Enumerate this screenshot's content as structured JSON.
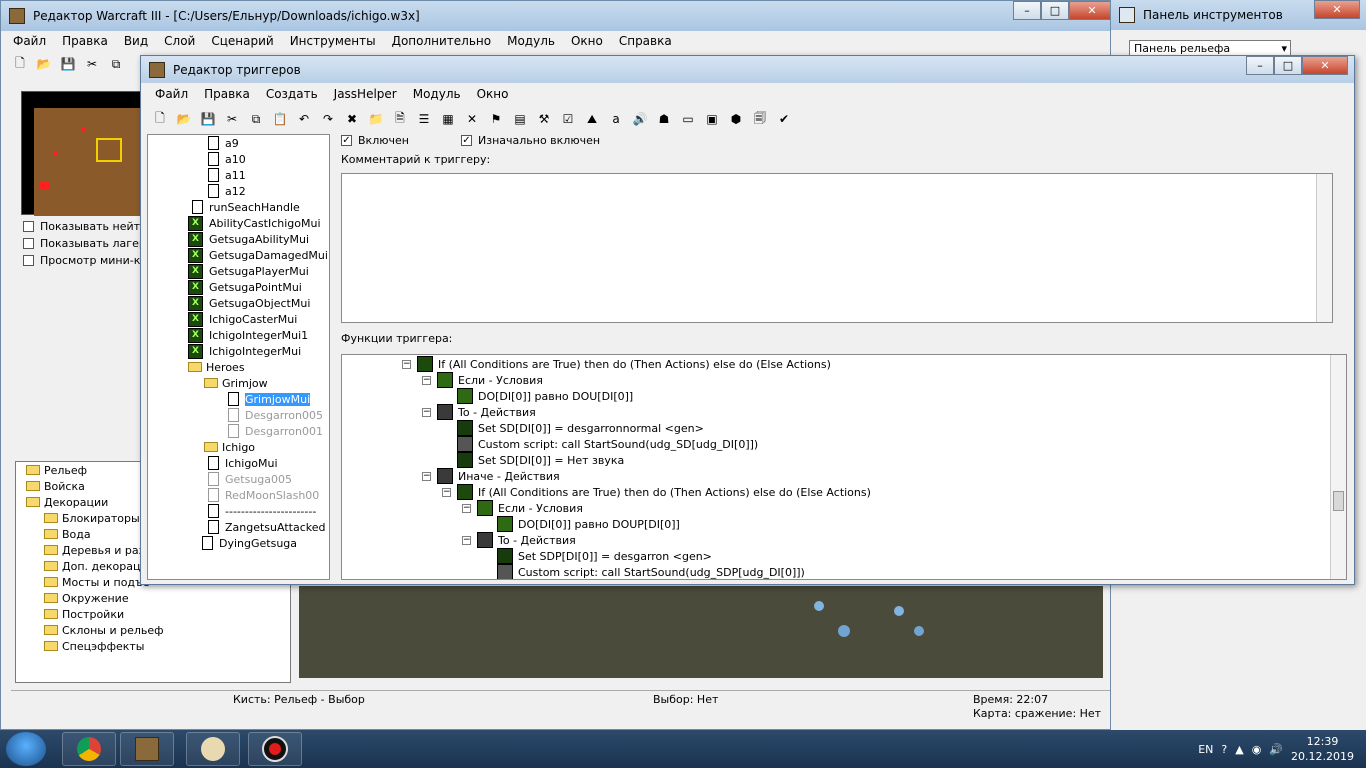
{
  "main_window": {
    "title": "Редактор Warcraft III  - [C:/Users/Ельнур/Downloads/ichigo.w3x]",
    "menu": [
      "Файл",
      "Правка",
      "Вид",
      "Слой",
      "Сценарий",
      "Инструменты",
      "Дополнительно",
      "Модуль",
      "Окно",
      "Справка"
    ],
    "checkboxes": [
      "Показывать нейтра",
      "Показывать лагеря",
      "Просмотр мини-кар"
    ],
    "tileset": {
      "items": [
        "Рельеф",
        "Войска",
        "Декорации",
        "Блокираторы п",
        "Вода",
        "Деревья и разр",
        "Доп. декораци",
        "Мосты и подъе",
        "Окружение",
        "Постройки",
        "Склоны и рельеф",
        "Спецэффекты"
      ]
    },
    "status": {
      "brush": "Кисть: Рельеф - Выбор",
      "selection": "Выбор: Нет",
      "time": "Время: 22:07",
      "map": "Карта: сражение: Нет"
    }
  },
  "tool_panel": {
    "title": "Панель инструментов",
    "dropdown": "Панель рельефа"
  },
  "trigger_editor": {
    "title": "Редактор триггеров",
    "menu": [
      "Файл",
      "Правка",
      "Создать",
      "JassHelper",
      "Модуль",
      "Окно"
    ],
    "enabled_label": "Включен",
    "initially_enabled_label": "Изначально включен",
    "comment_label": "Комментарий к триггеру:",
    "functions_label": "Функции триггера:",
    "tree": [
      {
        "label": "a9",
        "type": "doc"
      },
      {
        "label": "a10",
        "type": "doc"
      },
      {
        "label": "a11",
        "type": "doc"
      },
      {
        "label": "a12",
        "type": "doc"
      },
      {
        "label": "runSeachHandle",
        "type": "doc"
      },
      {
        "label": "AbilityCastIchigoMui",
        "type": "trig"
      },
      {
        "label": "GetsugaAbilityMui",
        "type": "trig"
      },
      {
        "label": "GetsugaDamagedMui",
        "type": "trig"
      },
      {
        "label": "GetsugaPlayerMui",
        "type": "trig"
      },
      {
        "label": "GetsugaPointMui",
        "type": "trig"
      },
      {
        "label": "GetsugaObjectMui",
        "type": "trig"
      },
      {
        "label": "IchigoCasterMui",
        "type": "trig"
      },
      {
        "label": "IchigoIntegerMui1",
        "type": "trig"
      },
      {
        "label": "IchigoIntegerMui",
        "type": "trig"
      },
      {
        "label": "Heroes",
        "type": "folder"
      },
      {
        "label": "Grimjow",
        "type": "folder"
      },
      {
        "label": "GrimjowMui",
        "type": "doc"
      },
      {
        "label": "Desgarron005",
        "type": "doc-dis"
      },
      {
        "label": "Desgarron001",
        "type": "doc-dis"
      },
      {
        "label": "Ichigo",
        "type": "folder"
      },
      {
        "label": "IchigoMui",
        "type": "doc"
      },
      {
        "label": "Getsuga005",
        "type": "doc-dis"
      },
      {
        "label": "RedMoonSlash00",
        "type": "doc-dis"
      },
      {
        "label": "-----------------------",
        "type": "sep"
      },
      {
        "label": "ZangetsuAttacked",
        "type": "doc"
      },
      {
        "label": "DyingGetsuga",
        "type": "doc"
      }
    ],
    "functions": [
      {
        "text": "If (All Conditions are True) then do (Then Actions) else do (Else Actions)",
        "icon": "if"
      },
      {
        "text": "Если - Условия",
        "icon": "cond"
      },
      {
        "text": "DO[DI[0]] равно DOU[DI[0]]",
        "icon": "cond"
      },
      {
        "text": "To - Действия",
        "icon": "folder-ico"
      },
      {
        "text": "Set SD[DI[0]] = desgarronnormal <gen>",
        "icon": "act"
      },
      {
        "text": "Custom script:   call StartSound(udg_SD[udg_DI[0]])",
        "icon": "custom"
      },
      {
        "text": "Set SD[DI[0]] = Нет звука",
        "icon": "act"
      },
      {
        "text": "Иначе - Действия",
        "icon": "folder-ico"
      },
      {
        "text": "If (All Conditions are True) then do (Then Actions) else do (Else Actions)",
        "icon": "if"
      },
      {
        "text": "Если - Условия",
        "icon": "cond"
      },
      {
        "text": "DO[DI[0]] равно DOUP[DI[0]]",
        "icon": "cond"
      },
      {
        "text": "To - Действия",
        "icon": "folder-ico"
      },
      {
        "text": "Set SDP[DI[0]] = desgarron <gen>",
        "icon": "act"
      },
      {
        "text": "Custom script:   call StartSound(udg_SDP[udg_DI[0]])",
        "icon": "custom"
      }
    ]
  },
  "taskbar": {
    "lang": "EN",
    "time": "12:39",
    "date": "20.12.2019"
  }
}
